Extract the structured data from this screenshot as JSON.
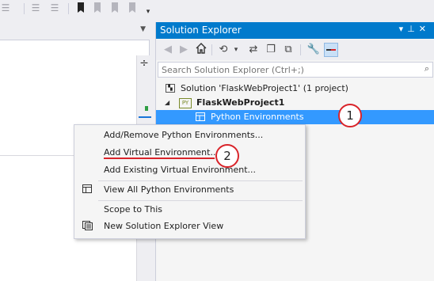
{
  "toolbar": {
    "icons": [
      "align-icon",
      "indent-icon",
      "outdent-icon",
      "bookmark-icon",
      "prev-bookmark-icon",
      "next-bookmark-icon",
      "clear-bookmark-icon",
      "toolbar-overflow-icon"
    ]
  },
  "solution_explorer": {
    "title": "Solution Explorer",
    "title_buttons": "▾ ✎ ✕",
    "search": {
      "placeholder": "Search Solution Explorer (Ctrl+;)",
      "value": ""
    },
    "tree": {
      "solution_label": "Solution 'FlaskWebProject1' (1 project)",
      "project_label": "FlaskWebProject1",
      "project_icon_text": "PY",
      "environments_label": "Python Environments"
    }
  },
  "annotations": {
    "badge_1": "1",
    "badge_2": "2"
  },
  "context_menu": {
    "items": [
      {
        "label": "Add/Remove Python Environments..."
      },
      {
        "label": "Add Virtual Environment..."
      },
      {
        "label": "Add Existing Virtual Environment..."
      },
      {
        "label": "View All Python Environments"
      },
      {
        "label": "Scope to This"
      },
      {
        "label": "New Solution Explorer View"
      }
    ]
  },
  "colors": {
    "accent": "#007acc",
    "selection": "#3399ff",
    "annotation_red": "#d9242a",
    "background": "#eeeef2"
  }
}
